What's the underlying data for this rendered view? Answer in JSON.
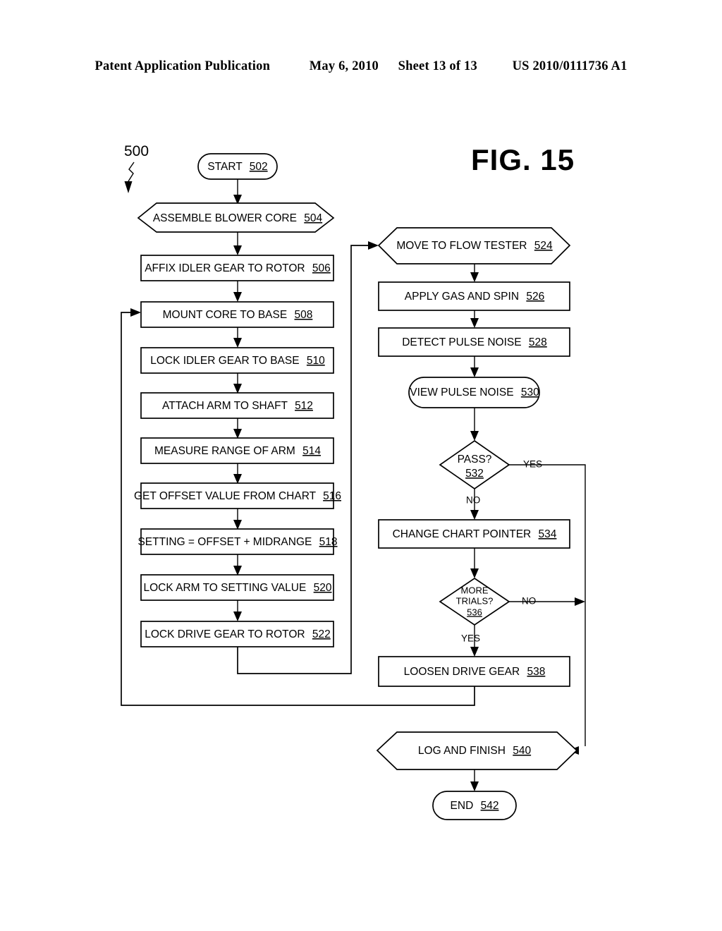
{
  "header": {
    "publication": "Patent Application Publication",
    "date": "May 6, 2010",
    "sheet": "Sheet 13 of 13",
    "docnum": "US 2010/0111736 A1"
  },
  "figure": {
    "title": "FIG. 15",
    "reference_numeral": "500"
  },
  "flowchart": {
    "nodes": [
      {
        "id": "502",
        "shape": "terminator",
        "text": "START",
        "num": "502"
      },
      {
        "id": "504",
        "shape": "hexagon",
        "text": "ASSEMBLE BLOWER CORE",
        "num": "504"
      },
      {
        "id": "506",
        "shape": "process",
        "text": "AFFIX IDLER GEAR TO ROTOR",
        "num": "506"
      },
      {
        "id": "508",
        "shape": "process",
        "text": "MOUNT CORE TO BASE",
        "num": "508"
      },
      {
        "id": "510",
        "shape": "process",
        "text": "LOCK IDLER GEAR TO BASE",
        "num": "510"
      },
      {
        "id": "512",
        "shape": "process",
        "text": "ATTACH ARM TO SHAFT",
        "num": "512"
      },
      {
        "id": "514",
        "shape": "process",
        "text": "MEASURE RANGE OF ARM",
        "num": "514"
      },
      {
        "id": "516",
        "shape": "process",
        "text": "GET OFFSET VALUE FROM CHART",
        "num": "516"
      },
      {
        "id": "518",
        "shape": "process",
        "text": "SETTING = OFFSET + MIDRANGE",
        "num": "518"
      },
      {
        "id": "520",
        "shape": "process",
        "text": "LOCK ARM TO SETTING VALUE",
        "num": "520"
      },
      {
        "id": "522",
        "shape": "process",
        "text": "LOCK DRIVE GEAR TO ROTOR",
        "num": "522"
      },
      {
        "id": "524",
        "shape": "hexagon",
        "text": "MOVE TO FLOW TESTER",
        "num": "524"
      },
      {
        "id": "526",
        "shape": "process",
        "text": "APPLY GAS AND SPIN",
        "num": "526"
      },
      {
        "id": "528",
        "shape": "process",
        "text": "DETECT PULSE NOISE",
        "num": "528"
      },
      {
        "id": "530",
        "shape": "terminator",
        "text": "VIEW PULSE NOISE",
        "num": "530"
      },
      {
        "id": "532",
        "shape": "decision",
        "text": "PASS?",
        "num": "532"
      },
      {
        "id": "534",
        "shape": "process",
        "text": "CHANGE CHART POINTER",
        "num": "534"
      },
      {
        "id": "536",
        "shape": "decision",
        "text": "MORE TRIALS?",
        "text_line1": "MORE",
        "text_line2": "TRIALS?",
        "num": "536"
      },
      {
        "id": "538",
        "shape": "process",
        "text": "LOOSEN DRIVE GEAR",
        "num": "538"
      },
      {
        "id": "540",
        "shape": "hexagon",
        "text": "LOG AND FINISH",
        "num": "540"
      },
      {
        "id": "542",
        "shape": "terminator",
        "text": "END",
        "num": "542"
      }
    ],
    "branch_labels": {
      "pass_yes": "YES",
      "pass_no": "NO",
      "more_trials_no": "NO",
      "more_trials_yes": "YES"
    }
  }
}
